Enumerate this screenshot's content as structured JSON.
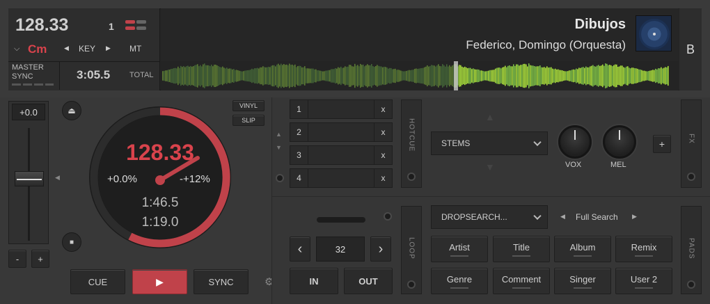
{
  "deck": {
    "bpm": "128.33",
    "deck_number": "1",
    "key": "Cm",
    "key_label": "KEY",
    "mt_label": "MT",
    "master_label": "MASTER",
    "sync_label": "SYNC",
    "total_time": "3:05.5",
    "total_label": "TOTAL",
    "letter": "B"
  },
  "track": {
    "title": "Dibujos",
    "artist": "Federico, Domingo (Orquesta)"
  },
  "pitch": {
    "value": "+0.0",
    "minus": "-",
    "plus": "+"
  },
  "jog": {
    "bpm": "128.33",
    "pitch": "+0.0%",
    "range": "-+12%",
    "elapsed": "1:46.5",
    "remaining": "1:19.0",
    "progress": 0.575
  },
  "modes": {
    "vinyl": "VINYL",
    "slip": "SLIP"
  },
  "transport": {
    "cue": "CUE",
    "play": "▶",
    "sync": "SYNC"
  },
  "hotcues": {
    "label": "HOTCUE",
    "items": [
      {
        "num": "1",
        "x": "x"
      },
      {
        "num": "2",
        "x": "x"
      },
      {
        "num": "3",
        "x": "x"
      },
      {
        "num": "4",
        "x": "x"
      }
    ]
  },
  "stems": {
    "dropdown": "STEMS",
    "knob1": "VOX",
    "knob2": "MEL",
    "add": "+",
    "fx_label": "FX"
  },
  "loop": {
    "label": "LOOP",
    "size": "32",
    "in": "IN",
    "out": "OUT",
    "prev": "‹",
    "next": "›"
  },
  "search": {
    "dropdown": "DROPSEARCH...",
    "mode": "Full Search",
    "pads_label": "PADS",
    "pads": [
      "Artist",
      "Title",
      "Album",
      "Remix",
      "Genre",
      "Comment",
      "Singer",
      "User 2"
    ]
  },
  "colors": {
    "accent": "#d9434c",
    "waveform": "#9fd93a"
  }
}
